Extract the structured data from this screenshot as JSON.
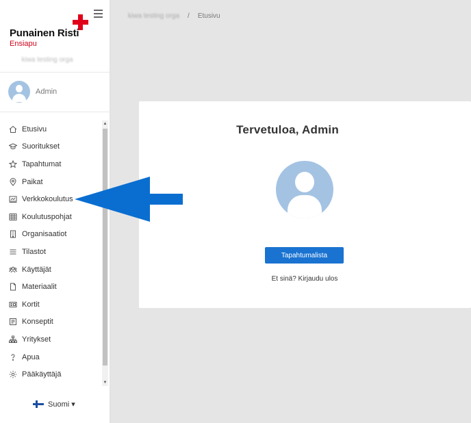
{
  "brand": {
    "name": "Punainen Risti",
    "sub": "Ensiapu"
  },
  "org_name": "kiwa testing orga",
  "user": {
    "name": "Admin"
  },
  "nav": {
    "items": [
      {
        "label": "Etusivu",
        "icon": "home-icon"
      },
      {
        "label": "Suoritukset",
        "icon": "graduation-cap-icon"
      },
      {
        "label": "Tapahtumat",
        "icon": "star-icon"
      },
      {
        "label": "Paikat",
        "icon": "map-pin-icon"
      },
      {
        "label": "Verkkokoulutus",
        "icon": "online-training-icon"
      },
      {
        "label": "Koulutuspohjat",
        "icon": "grid-table-icon"
      },
      {
        "label": "Organisaatiot",
        "icon": "building-icon"
      },
      {
        "label": "Tilastot",
        "icon": "list-icon"
      },
      {
        "label": "Käyttäjät",
        "icon": "users-icon"
      },
      {
        "label": "Materiaalit",
        "icon": "file-icon"
      },
      {
        "label": "Kortit",
        "icon": "card-icon"
      },
      {
        "label": "Konseptit",
        "icon": "concept-icon"
      },
      {
        "label": "Yritykset",
        "icon": "org-chart-icon"
      },
      {
        "label": "Apua",
        "icon": "help-icon"
      },
      {
        "label": "Pääkäyttäjä",
        "icon": "gear-icon"
      }
    ]
  },
  "language": {
    "label": "Suomi",
    "caret": "▾"
  },
  "breadcrumb": {
    "org": "kiwa testing orga",
    "separator": "/",
    "current": "Etusivu"
  },
  "card": {
    "title": "Tervetuloa, Admin",
    "button_label": "Tapahtumalista",
    "logout_text": "Et sinä? Kirjaudu ulos"
  },
  "colors": {
    "accent": "#1a73d1",
    "brand_red": "#e1001a",
    "avatar": "#a4c3e3",
    "annotation_arrow": "#0a6ed1"
  }
}
